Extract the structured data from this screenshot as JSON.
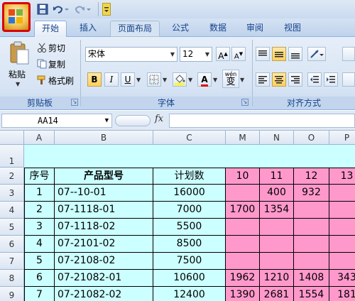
{
  "quick_access": {
    "icons": [
      "office-button",
      "save-icon",
      "undo-icon",
      "redo-icon",
      "customize-icon"
    ]
  },
  "tabs": [
    {
      "label": "开始",
      "active": true
    },
    {
      "label": "插入"
    },
    {
      "label": "页面布局"
    },
    {
      "label": "公式"
    },
    {
      "label": "数据"
    },
    {
      "label": "审阅"
    },
    {
      "label": "视图"
    }
  ],
  "clipboard": {
    "paste": "粘贴",
    "cut": "剪切",
    "copy": "复制",
    "format_painter": "格式刷",
    "group_label": "剪贴板"
  },
  "font": {
    "name": "宋体",
    "size": "12",
    "bold": "B",
    "italic": "I",
    "underline": "U",
    "grow": "A",
    "shrink": "A",
    "font_color": "A",
    "phonetic": "wén",
    "phonetic_char": "变",
    "group_label": "字体"
  },
  "alignment": {
    "group_label": "对齐方式"
  },
  "formula_bar": {
    "name_box": "AA14",
    "fx": "fx",
    "formula": ""
  },
  "columns": [
    "A",
    "B",
    "C",
    "M",
    "N",
    "O",
    "P"
  ],
  "rows": [
    "1",
    "2",
    "3",
    "4",
    "5",
    "6",
    "7",
    "8",
    "9"
  ],
  "table": {
    "headers": [
      "序号",
      "产品型号",
      "计划数",
      "10",
      "11",
      "12",
      "13"
    ],
    "records": [
      [
        "1",
        "07--10-01",
        "16000",
        "",
        "400",
        "932",
        ""
      ],
      [
        "2",
        "07-1118-01",
        "7000",
        "1700",
        "1354",
        "",
        ""
      ],
      [
        "3",
        "07-1118-02",
        "5500",
        "",
        "",
        "",
        ""
      ],
      [
        "4",
        "07-2101-02",
        "8500",
        "",
        "",
        "",
        ""
      ],
      [
        "5",
        "07-2108-02",
        "7500",
        "",
        "",
        "",
        ""
      ],
      [
        "6",
        "07-21082-01",
        "10600",
        "1962",
        "1210",
        "1408",
        "343"
      ],
      [
        "7",
        "07-21082-02",
        "12400",
        "1390",
        "2681",
        "1554",
        "181"
      ]
    ]
  },
  "colors": {
    "cyan_fill": "#ccffff",
    "pink_fill": "#ff99cc",
    "office_button_highlight": "#d80000"
  }
}
